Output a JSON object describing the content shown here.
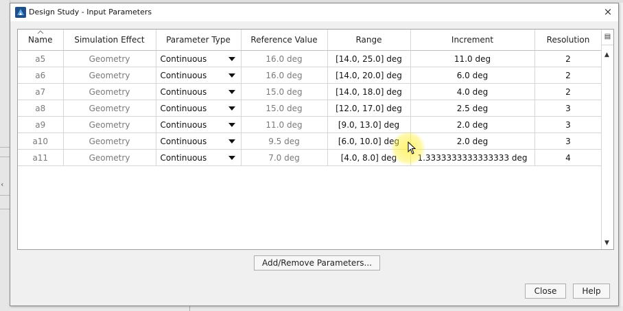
{
  "dialog": {
    "title": "Design Study - Input Parameters",
    "close_glyph": "×"
  },
  "table": {
    "columns": [
      "Name",
      "Simulation Effect",
      "Parameter Type",
      "Reference Value",
      "Range",
      "Increment",
      "Resolution"
    ],
    "rows": [
      {
        "name": "a5",
        "effect": "Geometry",
        "type": "Continuous",
        "ref": "16.0 deg",
        "range": "[14.0, 25.0] deg",
        "increment": "11.0 deg",
        "resolution": "2"
      },
      {
        "name": "a6",
        "effect": "Geometry",
        "type": "Continuous",
        "ref": "16.0 deg",
        "range": "[14.0, 20.0] deg",
        "increment": "6.0 deg",
        "resolution": "2"
      },
      {
        "name": "a7",
        "effect": "Geometry",
        "type": "Continuous",
        "ref": "15.0 deg",
        "range": "[14.0, 18.0] deg",
        "increment": "4.0 deg",
        "resolution": "2"
      },
      {
        "name": "a8",
        "effect": "Geometry",
        "type": "Continuous",
        "ref": "15.0 deg",
        "range": "[12.0, 17.0] deg",
        "increment": "2.5 deg",
        "resolution": "3"
      },
      {
        "name": "a9",
        "effect": "Geometry",
        "type": "Continuous",
        "ref": "11.0 deg",
        "range": "[9.0, 13.0] deg",
        "increment": "2.0 deg",
        "resolution": "3"
      },
      {
        "name": "a10",
        "effect": "Geometry",
        "type": "Continuous",
        "ref": "9.5 deg",
        "range": "[6.0, 10.0] deg",
        "increment": "2.0 deg",
        "resolution": "3"
      },
      {
        "name": "a11",
        "effect": "Geometry",
        "type": "Continuous",
        "ref": "7.0 deg",
        "range": "[4.0, 8.0] deg",
        "increment": "1.3333333333333333 deg",
        "resolution": "4"
      }
    ]
  },
  "buttons": {
    "add_remove": "Add/Remove Parameters...",
    "close": "Close",
    "help": "Help"
  },
  "colors": {
    "readonly_text": "#7a7a7a",
    "highlight": "#fff03c"
  },
  "icons": {
    "app": "design-study-app-icon",
    "column_picker": "column-chooser-icon",
    "cursor": "mouse-pointer-icon"
  }
}
